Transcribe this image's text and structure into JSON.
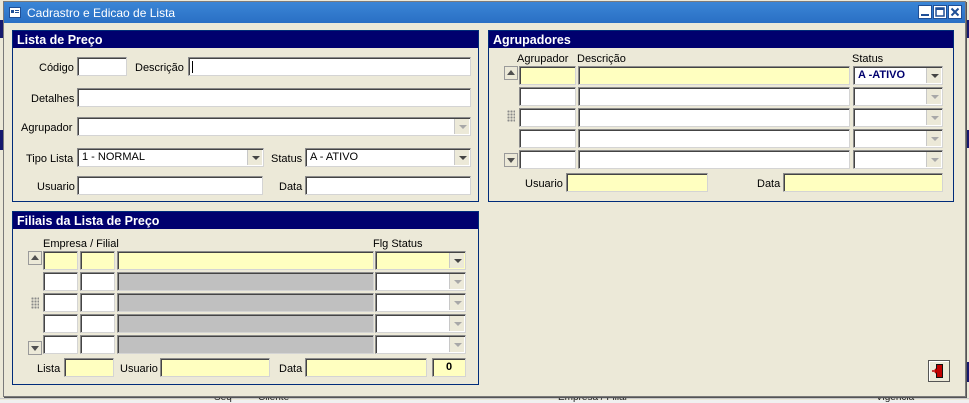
{
  "window": {
    "title": "Cadrastro e Edicao de Lista"
  },
  "backdrop": {
    "footer_cols": [
      "Seq",
      "Cliente",
      "Empresa / Filial",
      "Vigência"
    ]
  },
  "lista": {
    "title": "Lista de Preço",
    "codigo_label": "Código",
    "codigo_value": "",
    "descricao_label": "Descrição",
    "descricao_value": "",
    "detalhes_label": "Detalhes",
    "detalhes_value": "",
    "agrupador_label": "Agrupador",
    "agrupador_value": "",
    "tipo_label": "Tipo Lista",
    "tipo_value": "1 - NORMAL",
    "status_label": "Status",
    "status_value": "A - ATIVO",
    "usuario_label": "Usuario",
    "usuario_value": "",
    "data_label": "Data",
    "data_value": ""
  },
  "agrupadores": {
    "title": "Agrupadores",
    "col_agrupador": "Agrupador",
    "col_descricao": "Descrição",
    "col_status": "Status",
    "rows": [
      {
        "agrupador": "",
        "descricao": "",
        "status": "A -ATIVO"
      },
      {
        "agrupador": "",
        "descricao": "",
        "status": ""
      },
      {
        "agrupador": "",
        "descricao": "",
        "status": ""
      },
      {
        "agrupador": "",
        "descricao": "",
        "status": ""
      },
      {
        "agrupador": "",
        "descricao": "",
        "status": ""
      }
    ],
    "usuario_label": "Usuario",
    "usuario_value": "",
    "data_label": "Data",
    "data_value": ""
  },
  "filiais": {
    "title": "Filiais da Lista de Preço",
    "col_empresa": "Empresa / Filial",
    "col_flg": "Flg Status",
    "rows": [
      {
        "empresa": "",
        "filial": "",
        "nome": "",
        "flg": ""
      },
      {
        "empresa": "",
        "filial": "",
        "nome": "",
        "flg": ""
      },
      {
        "empresa": "",
        "filial": "",
        "nome": "",
        "flg": ""
      },
      {
        "empresa": "",
        "filial": "",
        "nome": "",
        "flg": ""
      },
      {
        "empresa": "",
        "filial": "",
        "nome": "",
        "flg": ""
      }
    ],
    "lista_label": "Lista",
    "lista_value": "",
    "usuario_label": "Usuario",
    "usuario_value": "",
    "data_label": "Data",
    "data_value": "",
    "count_value": "0"
  },
  "colors": {
    "panel_header": "#00006e",
    "required_field": "#ffffc0",
    "title_bar": "#2a6fc4"
  },
  "icons": {
    "app": "form-window-icon",
    "exit": "exit-door-icon"
  }
}
